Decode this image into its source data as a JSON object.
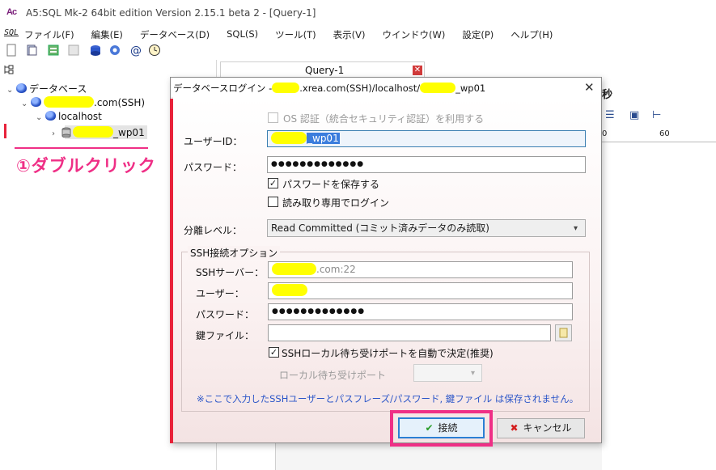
{
  "app": {
    "window_title": "A5:SQL Mk-2 64bit edition Version 2.15.1 beta 2 - [Query-1]",
    "icon_text": "Ac"
  },
  "menubar": {
    "logo": "SQL",
    "items": [
      "ファイル(F)",
      "編集(E)",
      "データベース(D)",
      "SQL(S)",
      "ツール(T)",
      "表示(V)",
      "ウインドウ(W)",
      "設定(P)",
      "ヘルプ(H)"
    ]
  },
  "tree": {
    "root_label": "データベース",
    "server_label": ".com(SSH)",
    "host_label": "localhost",
    "database_label": "_wp01"
  },
  "annotation": {
    "text": "①ダブルクリック"
  },
  "editor": {
    "tab_label": "Query-1",
    "ruler_0": "0",
    "ruler_60": "60",
    "partial_char": "秒"
  },
  "dialog": {
    "title_prefix": "データベースログイン -",
    "title_middle": ".xrea.com(SSH)/localhost/",
    "title_suffix": "_wp01",
    "os_auth_label": "OS 認証（統合セキュリティ認証）を利用する",
    "os_auth_checked": false,
    "user_id_label": "ユーザーID：",
    "user_id_value": "_wp01",
    "password_label": "パスワード：",
    "password_value": "●●●●●●●●●●●●●",
    "save_password_label": "パスワードを保存する",
    "save_password_checked": true,
    "readonly_label": "読み取り専用でログイン",
    "readonly_checked": false,
    "isolation_label": "分離レベル：",
    "isolation_value": "Read Committed (コミット済みデータのみ読取)",
    "ssh_group_label": "SSH接続オプション",
    "ssh_server_label": "SSHサーバー：",
    "ssh_server_value": ".com:22",
    "ssh_user_label": "ユーザー：",
    "ssh_password_label": "パスワード：",
    "ssh_password_value": "●●●●●●●●●●●●●",
    "key_file_label": "鍵ファイル：",
    "auto_port_label": "SSHローカル待ち受けポートを自動で決定(推奨)",
    "auto_port_checked": true,
    "local_port_label": "ローカル待ち受けポート",
    "note": "※ここで入力したSSHユーザーとパスフレーズ/パスワード, 鍵ファイル は保存されません。",
    "connect_label": "接続",
    "cancel_label": "キャンセル"
  },
  "colors": {
    "accent_red": "#e8223a",
    "annotation_pink": "#ef2f86",
    "mask_yellow": "#ffff00",
    "link_blue": "#2a55c8"
  }
}
